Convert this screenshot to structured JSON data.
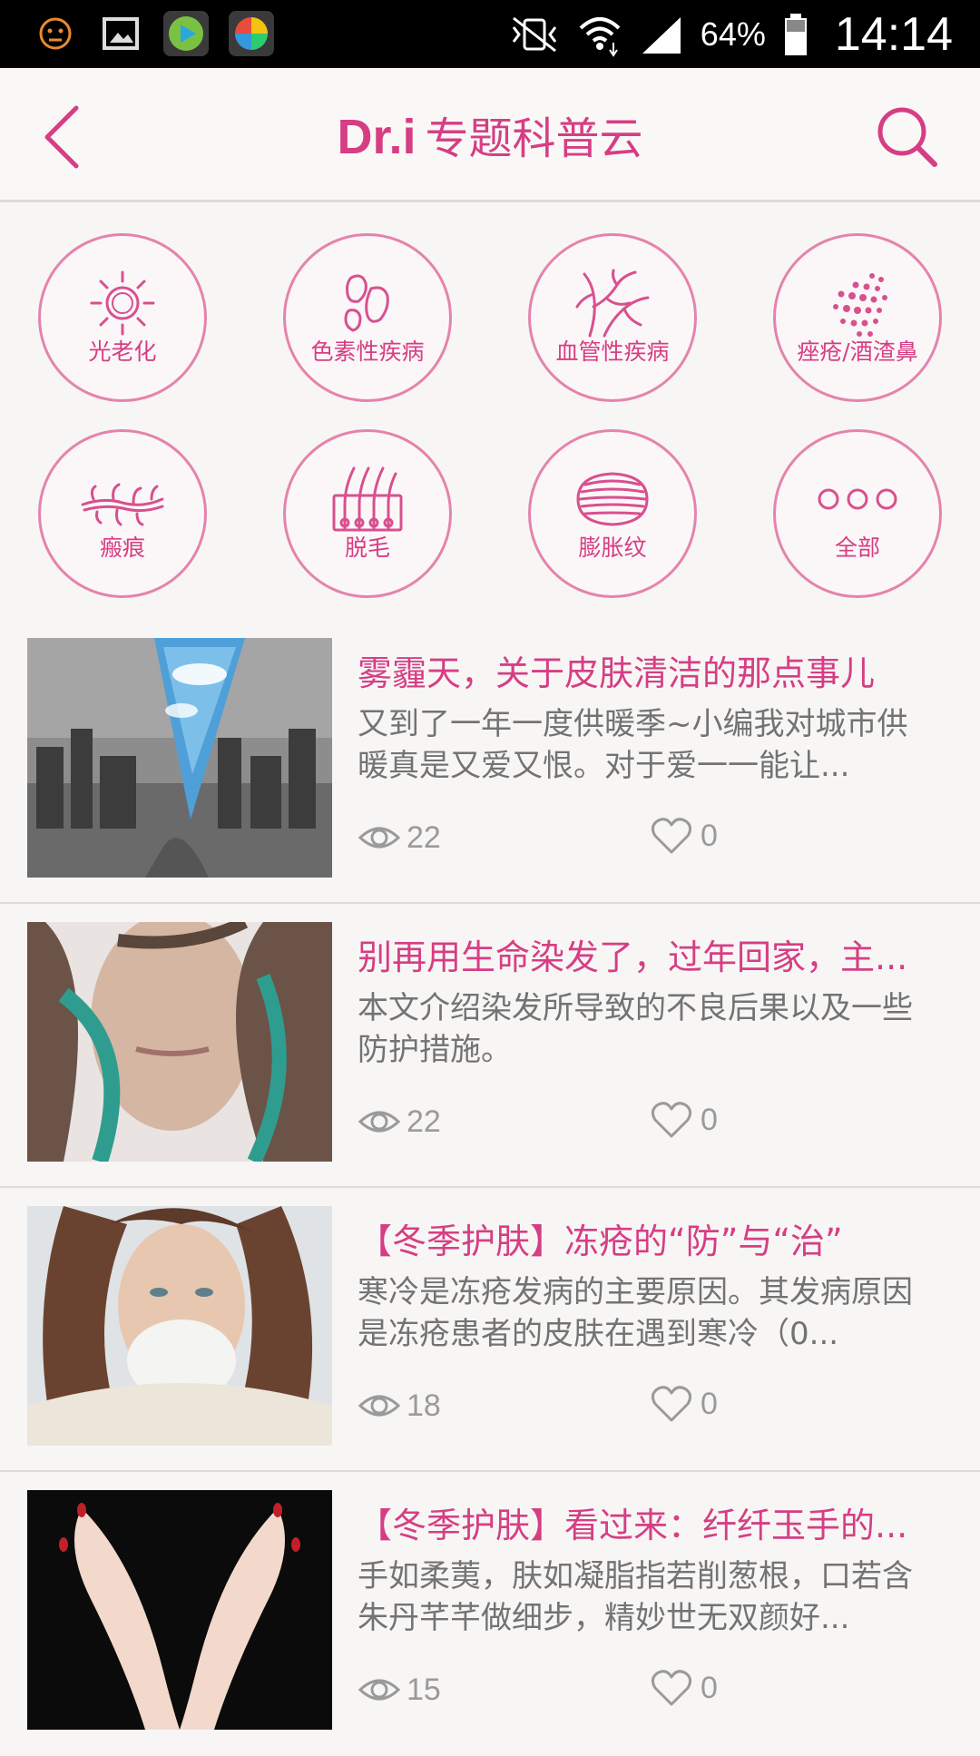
{
  "status_bar": {
    "battery": "64%",
    "time": "14:14"
  },
  "header": {
    "brand": "Dr.i",
    "title": "专题科普云"
  },
  "categories": [
    {
      "label": "光老化",
      "icon": "sun-icon"
    },
    {
      "label": "色素性疾病",
      "icon": "pigment-icon"
    },
    {
      "label": "血管性疾病",
      "icon": "vessel-icon"
    },
    {
      "label": "痤疮/酒渣鼻",
      "icon": "acne-dots-icon"
    },
    {
      "label": "瘢痕",
      "icon": "scar-icon"
    },
    {
      "label": "脱毛",
      "icon": "hair-follicle-icon"
    },
    {
      "label": "膨胀纹",
      "icon": "stretch-mark-icon"
    },
    {
      "label": "全部",
      "icon": "more-dots-icon"
    }
  ],
  "articles": [
    {
      "title": "雾霾天，关于皮肤清洁的那点事儿",
      "desc": "又到了一年一度供暖季~小编我对城市供暖真是又爱又恨。对于爱一一能让...",
      "views": "22",
      "likes": "0"
    },
    {
      "title": "别再用生命染发了，过年回家，主...",
      "desc": "本文介绍染发所导致的不良后果以及一些防护措施。",
      "views": "22",
      "likes": "0"
    },
    {
      "title": "【冬季护肤】冻疮的“防”与“治”",
      "desc": "寒冷是冻疮发病的主要原因。其发病原因是冻疮患者的皮肤在遇到寒冷（0...",
      "views": "18",
      "likes": "0"
    },
    {
      "title": "【冬季护肤】看过来：纤纤玉手的...",
      "desc": "手如柔荑，肤如凝脂指若削葱根，口若含朱丹芊芊做细步，精妙世无双颜好...",
      "views": "15",
      "likes": "0"
    }
  ],
  "colors": {
    "accent": "#d63e84",
    "circle_border": "#e583ad"
  }
}
